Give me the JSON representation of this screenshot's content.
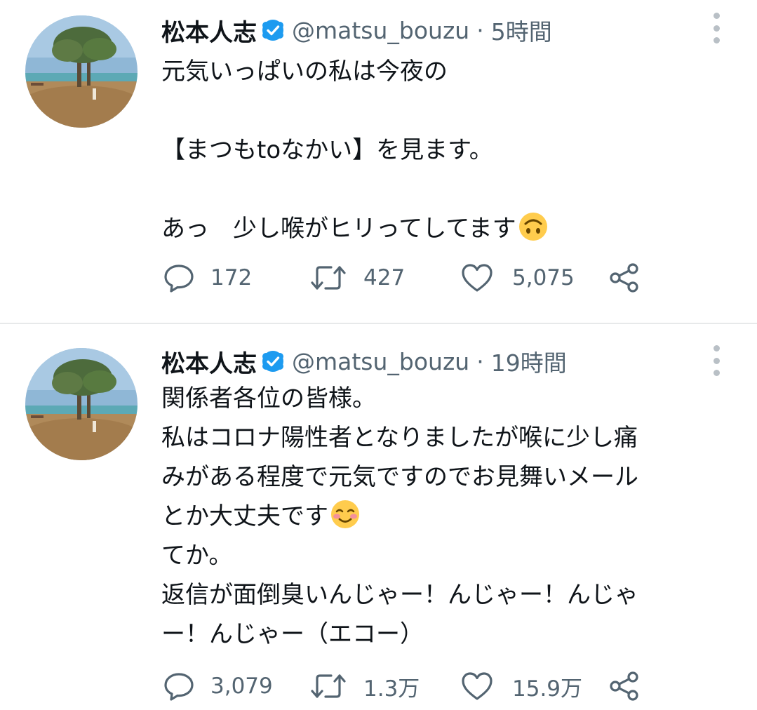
{
  "tweets": [
    {
      "display_name": "松本人志",
      "handle": "@matsu_bouzu",
      "separator": "·",
      "time": "5時間",
      "lines": [
        "元気いっぱいの私は今夜の",
        "",
        "【まつもtoなかい】を見ます。",
        "",
        "あっ　少し喉がヒリってしてます"
      ],
      "emoji": "upside-down-face-emoji",
      "counts": {
        "reply": "172",
        "retweet": "427",
        "like": "5,075"
      }
    },
    {
      "display_name": "松本人志",
      "handle": "@matsu_bouzu",
      "separator": "·",
      "time": "19時間",
      "lines": [
        "関係者各位の皆様。",
        "私はコロナ陽性者となりましたが喉に少し痛",
        "みがある程度で元気ですのでお見舞いメール",
        "とか大丈夫です",
        "てか。",
        "返信が面倒臭いんじゃー！んじゃー！んじゃ",
        "ー！んじゃー（エコー）"
      ],
      "emoji": "smiling-face-emoji",
      "counts": {
        "reply": "3,079",
        "retweet": "1.3万",
        "like": "15.9万"
      }
    }
  ],
  "colors": {
    "text": "#0f1419",
    "secondary": "#536471",
    "verified": "#1d9bf0",
    "divider": "#e7e9ea"
  },
  "icons": {
    "reply": "reply-icon",
    "retweet": "retweet-icon",
    "like": "like-icon",
    "share": "share-icon",
    "more": "more-icon",
    "verified": "verified-badge-icon"
  }
}
